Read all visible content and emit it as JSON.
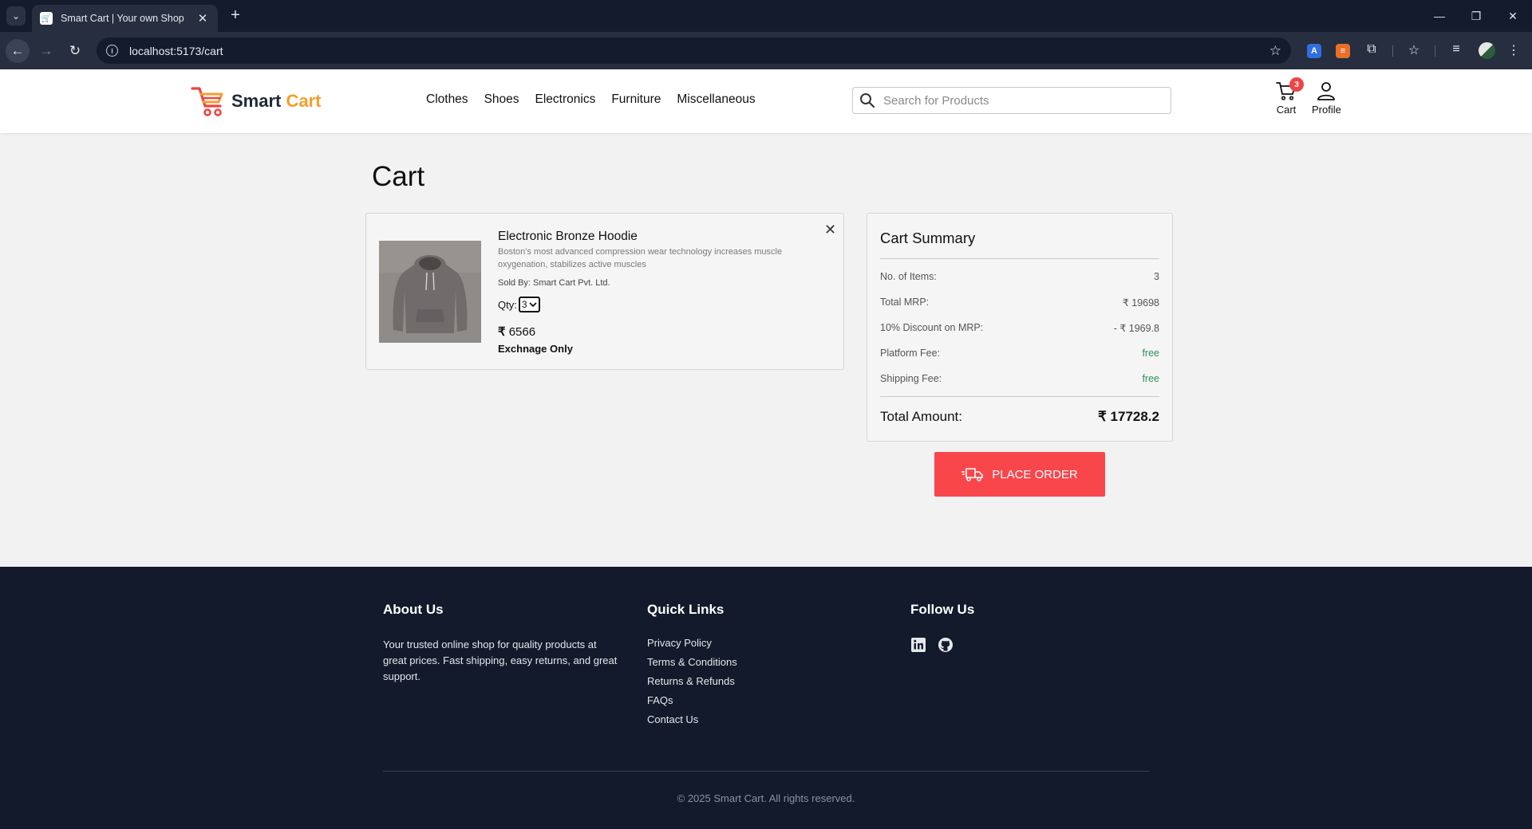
{
  "browser": {
    "tab_title": "Smart Cart | Your own Shop",
    "url": "localhost:5173/cart"
  },
  "header": {
    "logo_smart": "Smart",
    "logo_cart": "Cart",
    "nav": [
      "Clothes",
      "Shoes",
      "Electronics",
      "Furniture",
      "Miscellaneous"
    ],
    "search_placeholder": "Search for Products",
    "cart_label": "Cart",
    "cart_count": "3",
    "profile_label": "Profile"
  },
  "page": {
    "title": "Cart"
  },
  "cart_item": {
    "name": "Electronic Bronze Hoodie",
    "description": "Boston's most advanced compression wear technology increases muscle oxygenation, stabilizes active muscles",
    "seller": "Sold By: Smart Cart Pvt. Ltd.",
    "qty_label": "Qty:",
    "qty_value": "3",
    "currency": "₹",
    "price": "6566",
    "return_policy": "Exchnage Only"
  },
  "summary": {
    "title": "Cart Summary",
    "rows": [
      {
        "label": "No. of Items:",
        "value": "3"
      },
      {
        "label": "Total MRP:",
        "value": "₹ 19698"
      },
      {
        "label": "10% Discount on MRP:",
        "value": "- ₹ 1969.8"
      },
      {
        "label": "Platform Fee:",
        "value": "free"
      },
      {
        "label": "Shipping Fee:",
        "value": "free"
      }
    ],
    "total_label": "Total Amount:",
    "total_value": "₹ 17728.2",
    "place_order": "PLACE ORDER"
  },
  "footer": {
    "about_heading": "About Us",
    "about_text": "Your trusted online shop for quality products at great prices. Fast shipping, easy returns, and great support.",
    "links_heading": "Quick Links",
    "links": [
      "Privacy Policy",
      "Terms & Conditions",
      "Returns & Refunds",
      "FAQs",
      "Contact Us"
    ],
    "follow_heading": "Follow Us",
    "social_icons": [
      "linkedin-icon",
      "github-icon"
    ],
    "copyright": "© 2025 Smart Cart. All rights reserved."
  },
  "colors": {
    "accent": "#f9464b",
    "logo_orange": "#f59e2b",
    "footer_bg": "#121a2b",
    "free_green": "#2f8f5b"
  }
}
